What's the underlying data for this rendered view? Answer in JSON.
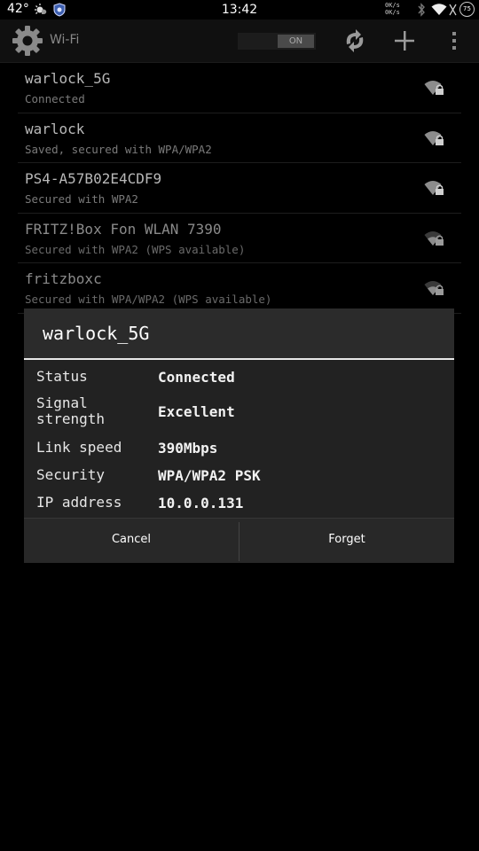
{
  "status_bar": {
    "temperature": "42°",
    "time": "13:42",
    "rate_up": "0K/s",
    "rate_down": "0K/s",
    "battery": "75",
    "icons": [
      "weather-icon",
      "app-notification-icon",
      "bluetooth-icon",
      "wifi-icon",
      "battery-icon"
    ]
  },
  "action_bar": {
    "title": "Wi-Fi",
    "toggle_label": "ON",
    "icons": [
      "settings-gear-icon",
      "wps-refresh-icon",
      "add-network-icon",
      "overflow-menu-icon"
    ]
  },
  "networks": [
    {
      "name": "warlock_5G",
      "status": "Connected",
      "signal": "full"
    },
    {
      "name": "warlock",
      "status": "Saved, secured with WPA/WPA2",
      "signal": "full"
    },
    {
      "name": "PS4-A57B02E4CDF9",
      "status": "Secured with WPA2",
      "signal": "full"
    },
    {
      "name": "FRITZ!Box Fon WLAN 7390",
      "status": "Secured with WPA2 (WPS available)",
      "signal": "weak"
    },
    {
      "name": "fritzboxc",
      "status": "Secured with WPA/WPA2 (WPS available)",
      "signal": "weak"
    }
  ],
  "dialog": {
    "title": "warlock_5G",
    "rows": [
      {
        "label": "Status",
        "value": "Connected"
      },
      {
        "label": "Signal strength",
        "value": "Excellent"
      },
      {
        "label": "Link speed",
        "value": "390Mbps"
      },
      {
        "label": "Security",
        "value": "WPA/WPA2 PSK"
      },
      {
        "label": "IP address",
        "value": "10.0.0.131"
      }
    ],
    "cancel_label": "Cancel",
    "forget_label": "Forget"
  },
  "colors": {
    "background": "#000000",
    "dialog": "#222222",
    "accent_line": "#e8e8e8",
    "text_primary": "#b8b8b8",
    "text_secondary": "#7a7a7a"
  }
}
